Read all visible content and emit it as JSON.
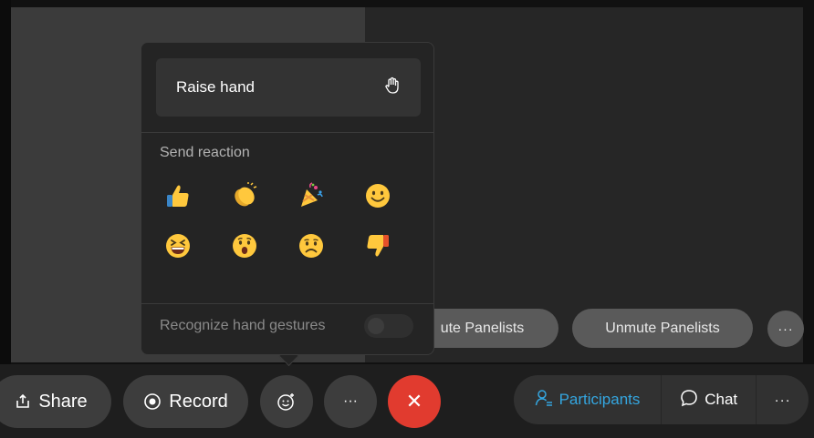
{
  "popup": {
    "raise_hand_label": "Raise hand",
    "send_reaction_label": "Send reaction",
    "reactions": [
      "thumbs-up",
      "clapping-hands",
      "party-popper",
      "smile",
      "laughing",
      "surprised",
      "sad",
      "thumbs-down"
    ],
    "gestures_label": "Recognize hand gestures",
    "gestures_enabled": false
  },
  "stage": {
    "mute_panelists_label": "ute Panelists",
    "unmute_panelists_label": "Unmute Panelists",
    "more_label": "···"
  },
  "controls": {
    "share_label": "Share",
    "record_label": "Record",
    "more_label": "···",
    "end_label": "✕",
    "participants_label": "Participants",
    "chat_label": "Chat",
    "right_more_label": "···"
  },
  "colors": {
    "accent": "#34a6e0",
    "end_call": "#e13b2f",
    "emoji_yellow": "#ffc83d"
  }
}
